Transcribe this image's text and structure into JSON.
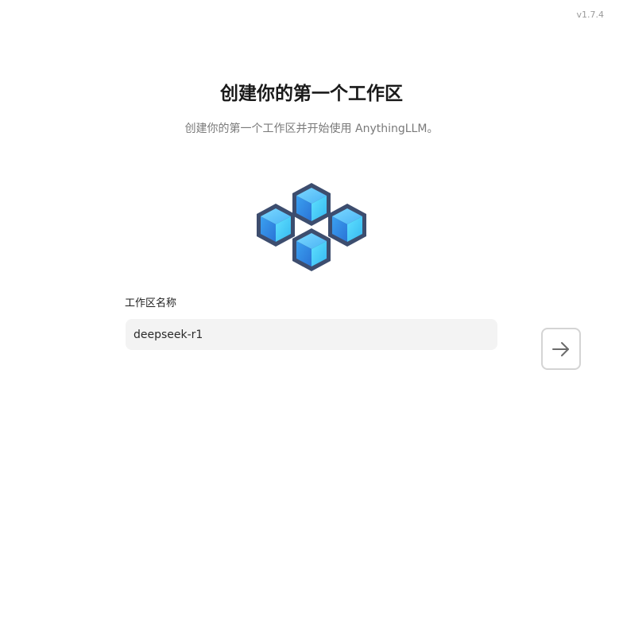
{
  "app": {
    "version": "v1.7.4"
  },
  "onboarding": {
    "title": "创建你的第一个工作区",
    "subtitle": "创建你的第一个工作区并开始使用 AnythingLLM。",
    "logo_icon": "workspace-cubes-icon",
    "workspace_name_label": "工作区名称",
    "workspace_name_value": "deepseek-r1",
    "next_icon": "arrow-right-icon"
  },
  "colors": {
    "title": "#1a1a1a",
    "subtitle": "#7a7a7a",
    "input_bg": "#f3f3f3",
    "button_border": "#d4d4d4",
    "cube_light": "#5fd1ff",
    "cube_dark": "#2a7fe0",
    "cube_edge": "#3d4d6e"
  }
}
